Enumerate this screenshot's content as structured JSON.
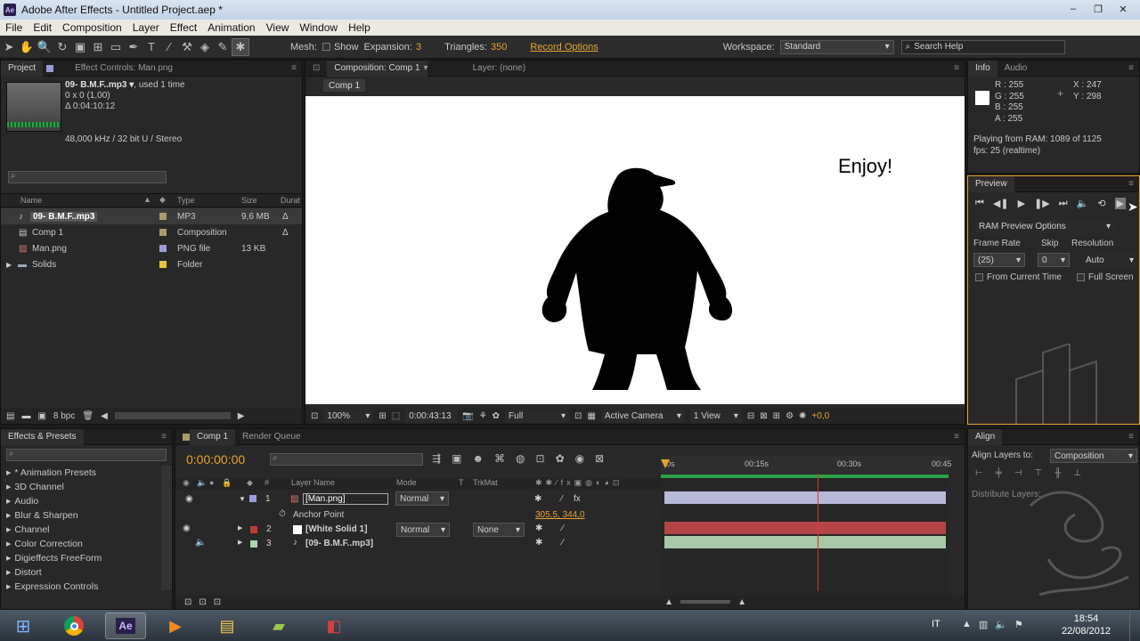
{
  "window": {
    "title": "Adobe After Effects - Untitled Project.aep *",
    "controls": [
      "–",
      "❐",
      "✕"
    ]
  },
  "menu": [
    "File",
    "Edit",
    "Composition",
    "Layer",
    "Effect",
    "Animation",
    "View",
    "Window",
    "Help"
  ],
  "toolbar": {
    "mesh_label": "Mesh:",
    "show_label": "Show",
    "expansion_label": "Expansion:",
    "expansion_value": "3",
    "triangles_label": "Triangles:",
    "triangles_value": "350",
    "record_options": "Record Options",
    "workspace_label": "Workspace:",
    "workspace_value": "Standard",
    "search_help": "Search Help"
  },
  "project": {
    "tabs": [
      "Project",
      "Effect Controls: Man.png"
    ],
    "item_name": "09- B.M.F..mp3 ▾",
    "item_used": ", used 1 time",
    "item_dims": "0 x 0 (1,00)",
    "item_duration": "Δ 0:04:10:12",
    "item_audio": "48,000 kHz / 32 bit U / Stereo",
    "columns": [
      "Name",
      "Type",
      "Size",
      "Durat"
    ],
    "items": [
      {
        "name": "09- B.M.F..mp3",
        "type": "MP3",
        "size": "9,6 MB",
        "dur": "Δ",
        "color": "#a89b6e"
      },
      {
        "name": "Comp 1",
        "type": "Composition",
        "size": "",
        "dur": "Δ",
        "color": "#a89b6e"
      },
      {
        "name": "Man.png",
        "type": "PNG file",
        "size": "13 KB",
        "dur": "",
        "color": "#9b9bd8"
      },
      {
        "name": "Solids",
        "type": "Folder",
        "size": "",
        "dur": "",
        "color": "#e8c53a"
      }
    ],
    "bpc": "8 bpc"
  },
  "composition": {
    "tab": "Composition: Comp 1",
    "layer_tab": "Layer: (none)",
    "breadcrumb": "Comp 1",
    "canvas_text": "Enjoy!",
    "zoom": "100%",
    "timecode": "0:00:43:13",
    "resolution": "Full",
    "camera": "Active Camera",
    "views": "1 View",
    "exposure": "+0,0"
  },
  "info": {
    "tabs": [
      "Info",
      "Audio"
    ],
    "r": "R : 255",
    "g": "G : 255",
    "b": "B : 255",
    "a": "A : 255",
    "x": "X : 247",
    "y": "Y : 298",
    "playing": "Playing from RAM: 1089 of 1125",
    "fps": "fps: 25 (realtime)"
  },
  "preview": {
    "tab": "Preview",
    "ram_options": "RAM Preview Options",
    "frame_rate_label": "Frame Rate",
    "skip_label": "Skip",
    "resolution_label": "Resolution",
    "frame_rate_value": "(25)",
    "skip_value": "0",
    "resolution_value": "Auto",
    "from_current": "From Current Time",
    "full_screen": "Full Screen"
  },
  "effects": {
    "tab": "Effects & Presets",
    "items": [
      "* Animation Presets",
      "3D Channel",
      "Audio",
      "Blur & Sharpen",
      "Channel",
      "Color Correction",
      "Digieffects FreeForm",
      "Distort",
      "Expression Controls"
    ]
  },
  "timeline": {
    "tabs": [
      "Comp 1",
      "Render Queue"
    ],
    "timecode": "0:00:00:00",
    "col_layer_name": "Layer Name",
    "col_mode": "Mode",
    "col_t": "T",
    "col_trkmat": "TrkMat",
    "ruler": [
      "0s",
      "00:15s",
      "00:30s",
      "00:45"
    ],
    "layers": [
      {
        "num": "1",
        "name": "[Man.png]",
        "mode": "Normal",
        "trkmat": "",
        "color": "#9b9bd8",
        "bar": "#b8b8d8"
      },
      {
        "num": "2",
        "name": "[White Solid 1]",
        "mode": "Normal",
        "trkmat": "None",
        "color": "#c23b3b",
        "bar": "#b54545"
      },
      {
        "num": "3",
        "name": "[09- B.M.F..mp3]",
        "mode": "",
        "trkmat": "",
        "color": "#a8d4b0",
        "bar": "#a8c8a8"
      }
    ],
    "anchor_label": "Anchor Point",
    "anchor_value": "305,5, 344,0"
  },
  "align": {
    "tab": "Align",
    "align_to_label": "Align Layers to:",
    "align_to_value": "Composition",
    "distribute_label": "Distribute Layers:"
  },
  "taskbar": {
    "lang": "IT",
    "time": "18:54",
    "date": "22/08/2012"
  }
}
